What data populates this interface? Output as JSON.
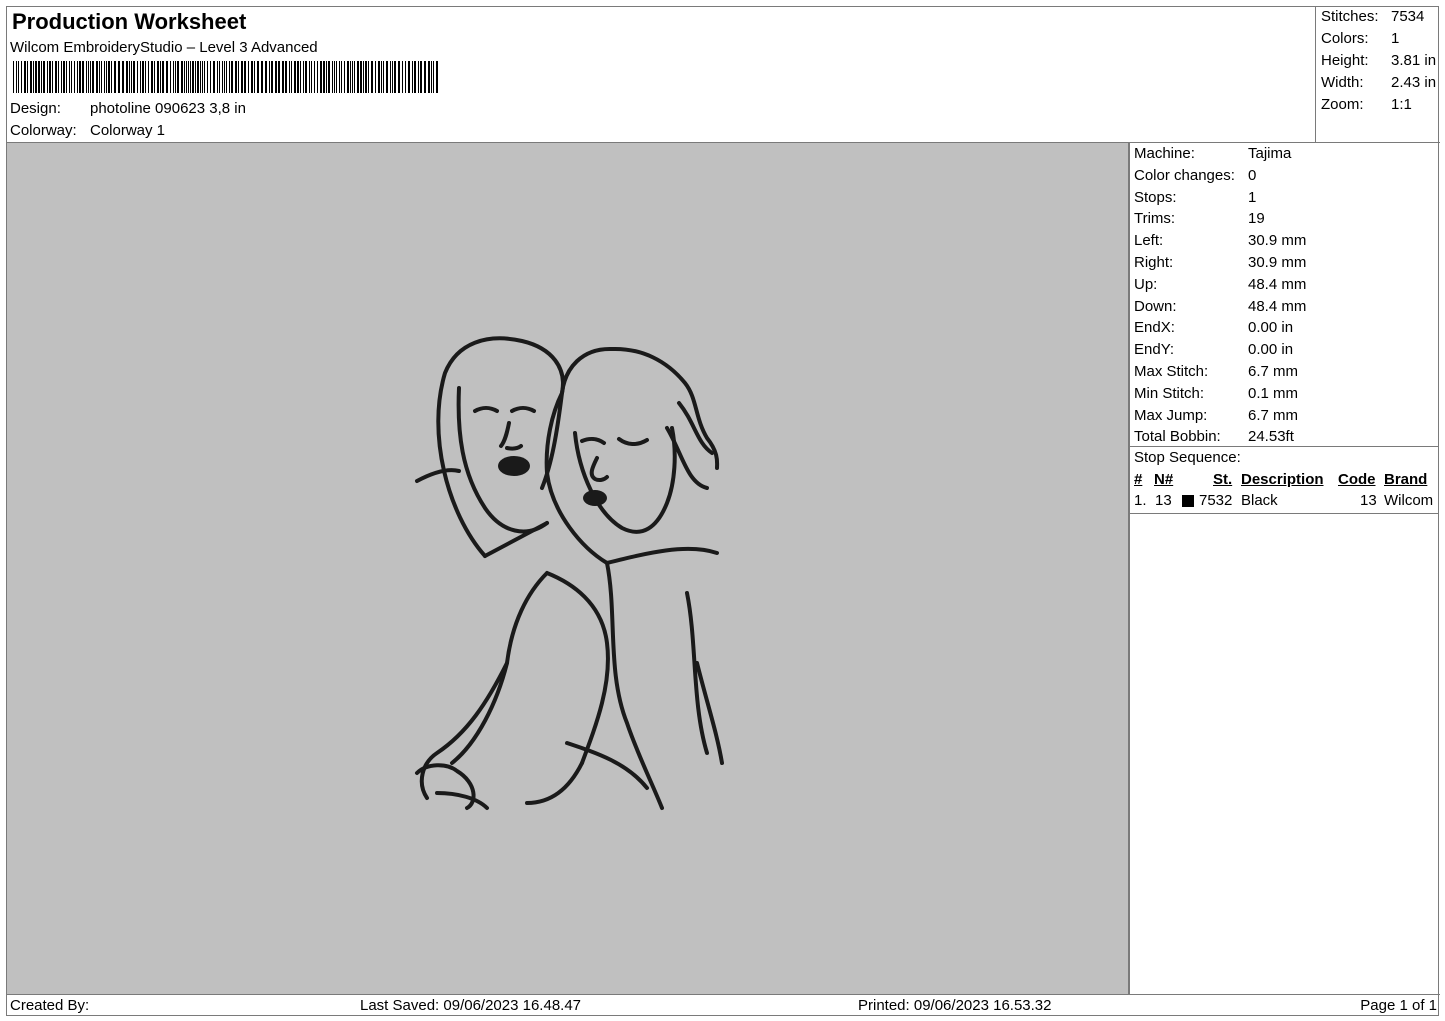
{
  "header": {
    "title": "Production Worksheet",
    "subtitle": "Wilcom EmbroideryStudio – Level 3 Advanced",
    "design_label": "Design:",
    "design_value": "photoline 090623 3,8 in",
    "colorway_label": "Colorway:",
    "colorway_value": "Colorway 1"
  },
  "summary": [
    {
      "label": "Stitches:",
      "value": "7534"
    },
    {
      "label": "Colors:",
      "value": "1"
    },
    {
      "label": "Height:",
      "value": "3.81 in"
    },
    {
      "label": "Width:",
      "value": "2.43 in"
    },
    {
      "label": "Zoom:",
      "value": "1:1"
    }
  ],
  "machine_info": [
    {
      "label": "Machine:",
      "value": "Tajima"
    },
    {
      "label": "Color changes:",
      "value": "0"
    },
    {
      "label": "Stops:",
      "value": "1"
    },
    {
      "label": "Trims:",
      "value": "19"
    },
    {
      "label": "Left:",
      "value": "30.9 mm"
    },
    {
      "label": "Right:",
      "value": "30.9 mm"
    },
    {
      "label": "Up:",
      "value": "48.4 mm"
    },
    {
      "label": "Down:",
      "value": "48.4 mm"
    },
    {
      "label": "EndX:",
      "value": "0.00 in"
    },
    {
      "label": "EndY:",
      "value": "0.00 in"
    },
    {
      "label": "Max Stitch:",
      "value": "6.7 mm"
    },
    {
      "label": "Min Stitch:",
      "value": "0.1 mm"
    },
    {
      "label": "Max Jump:",
      "value": "6.7 mm"
    },
    {
      "label": "Total Bobbin:",
      "value": "24.53ft"
    }
  ],
  "stop_sequence": {
    "title": "Stop Sequence:",
    "columns": {
      "num": "#",
      "needle": "N#",
      "stitches": "St.",
      "description": "Description",
      "code": "Code",
      "brand": "Brand"
    },
    "rows": [
      {
        "num": "1.",
        "needle": "13",
        "swatch_color": "#000000",
        "stitches": "7532",
        "description": "Black",
        "code": "13",
        "brand": "Wilcom"
      }
    ]
  },
  "design_preview": {
    "stitch_color": "#1a1a1a",
    "background": "#c0c0c0"
  },
  "footer": {
    "created_by": "Created By:",
    "last_saved": "Last Saved: 09/06/2023 16.48.47",
    "printed": "Printed: 09/06/2023 16.53.32",
    "page": "Page 1 of 1"
  }
}
